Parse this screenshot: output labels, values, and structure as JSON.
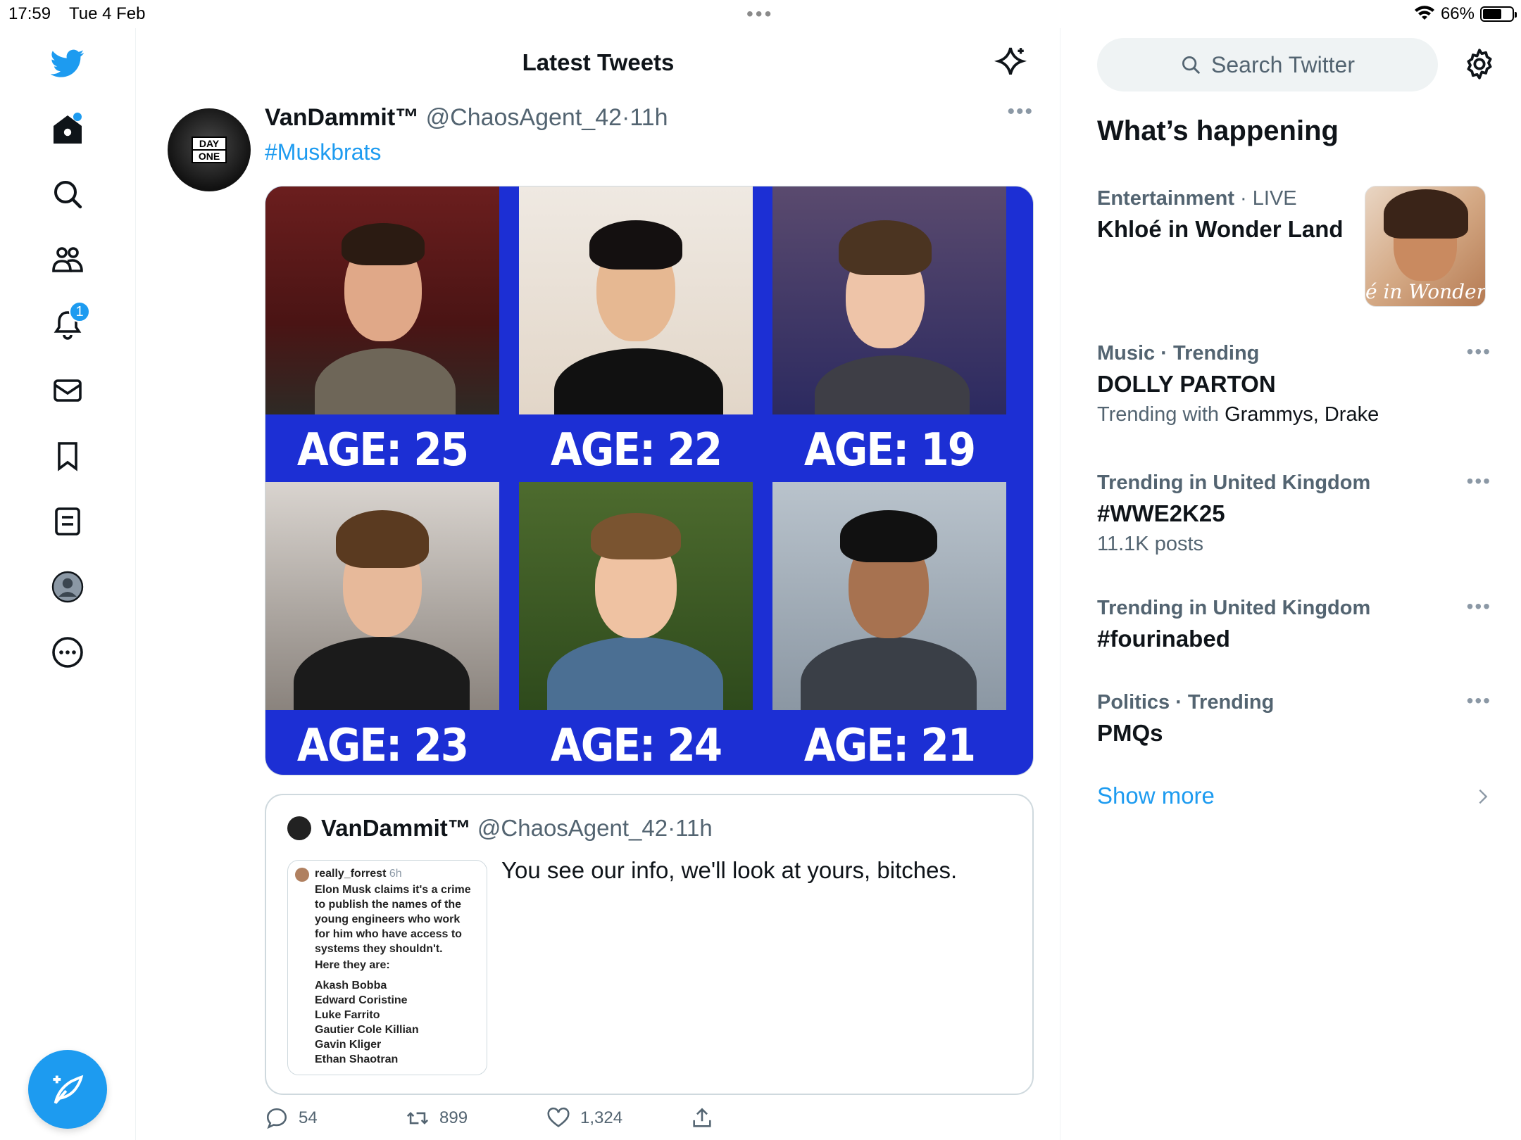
{
  "status": {
    "time": "17:59",
    "date": "Tue 4 Feb",
    "battery": "66%",
    "battery_level": 0.66
  },
  "nav": {
    "notifications_badge": "1",
    "items": [
      "home-icon",
      "search-icon",
      "communities-icon",
      "notifications-icon",
      "messages-icon",
      "bookmarks-icon",
      "lists-icon",
      "profile-icon",
      "more-icon"
    ]
  },
  "timeline": {
    "title": "Latest Tweets",
    "tweet": {
      "name": "VanDammit™",
      "handle": "@ChaosAgent_42",
      "sep": "·",
      "time": "11h",
      "text": "#Muskbrats",
      "avatar_text": [
        "DAY",
        "ONE"
      ],
      "media": [
        {
          "label": "AGE: 25"
        },
        {
          "label": "AGE: 22"
        },
        {
          "label": "AGE: 19"
        },
        {
          "label": "AGE: 23"
        },
        {
          "label": "AGE: 24"
        },
        {
          "label": "AGE: 21"
        }
      ],
      "quote": {
        "name": "VanDammit™",
        "handle": "@ChaosAgent_42",
        "sep": "·",
        "time": "11h",
        "text": "You see our info, we'll look at yours, bitches.",
        "embedded": {
          "user": "really_forrest",
          "time": "6h",
          "body": "Elon Musk claims it's a crime to publish the names of the young engineers who work for him who have access to systems they shouldn't.",
          "intro": "Here they are:",
          "names": [
            "Akash Bobba",
            "Edward Coristine",
            "Luke Farrito",
            "Gautier Cole Killian",
            "Gavin Kliger",
            "Ethan Shaotran"
          ]
        }
      },
      "actions": {
        "replies": "54",
        "retweets": "899",
        "likes": "1,324"
      }
    }
  },
  "sidebar": {
    "search_placeholder": "Search Twitter",
    "heading": "What’s happening",
    "trends": [
      {
        "category": "Entertainment",
        "sep": " · ",
        "live": "LIVE",
        "title": "Khloé in Wonder Land",
        "image_caption": "é in Wonder L"
      },
      {
        "category": "Music · Trending",
        "title": "DOLLY PARTON",
        "sub_prefix": "Trending with ",
        "sub_value": "Grammys, Drake"
      },
      {
        "category": "Trending in United Kingdom",
        "title": "#WWE2K25",
        "sub": "11.1K posts"
      },
      {
        "category": "Trending in United Kingdom",
        "title": "#fourinabed"
      },
      {
        "category": "Politics · Trending",
        "title": "PMQs"
      }
    ],
    "show_more": "Show more"
  },
  "colors": {
    "accent": "#1d9bf0",
    "media_bg": "#1c2fd4",
    "muted": "#536471"
  }
}
